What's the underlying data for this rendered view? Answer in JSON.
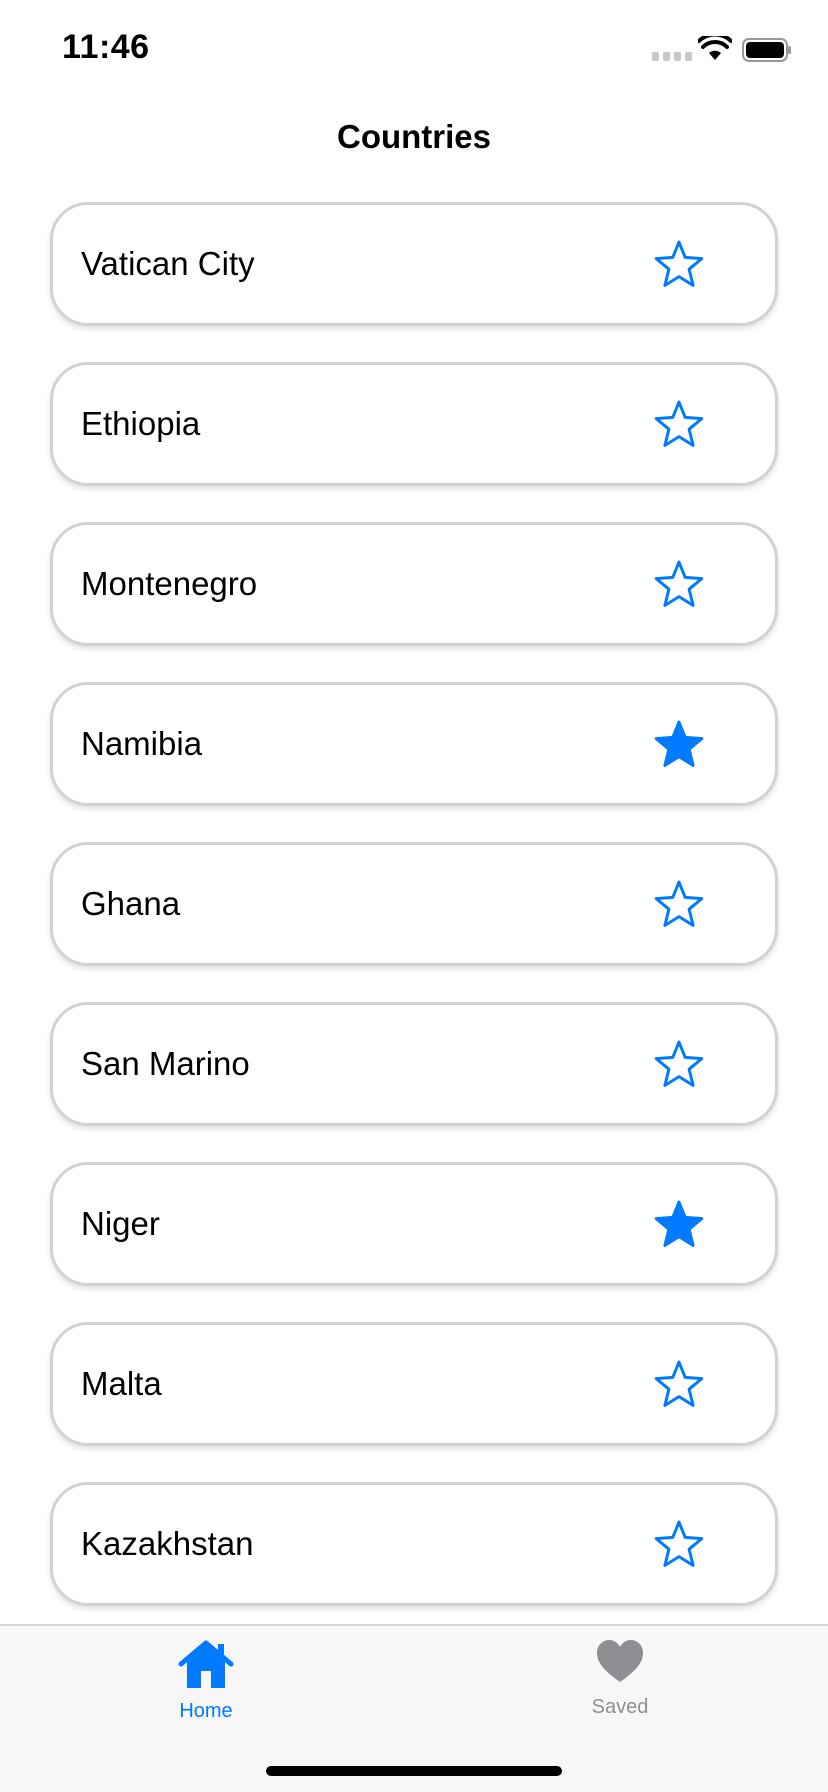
{
  "status_bar": {
    "time": "11:46"
  },
  "nav": {
    "title": "Countries"
  },
  "countries": [
    {
      "name": "Vatican City",
      "favorited": false
    },
    {
      "name": "Ethiopia",
      "favorited": false
    },
    {
      "name": "Montenegro",
      "favorited": false
    },
    {
      "name": "Namibia",
      "favorited": true
    },
    {
      "name": "Ghana",
      "favorited": false
    },
    {
      "name": "San Marino",
      "favorited": false
    },
    {
      "name": "Niger",
      "favorited": true
    },
    {
      "name": "Malta",
      "favorited": false
    },
    {
      "name": "Kazakhstan",
      "favorited": false
    }
  ],
  "tabs": [
    {
      "label": "Home",
      "icon": "house-icon",
      "selected": true
    },
    {
      "label": "Saved",
      "icon": "heart-icon",
      "selected": false
    }
  ],
  "colors": {
    "accent": "#007aff",
    "inactive": "#8e8e93"
  }
}
